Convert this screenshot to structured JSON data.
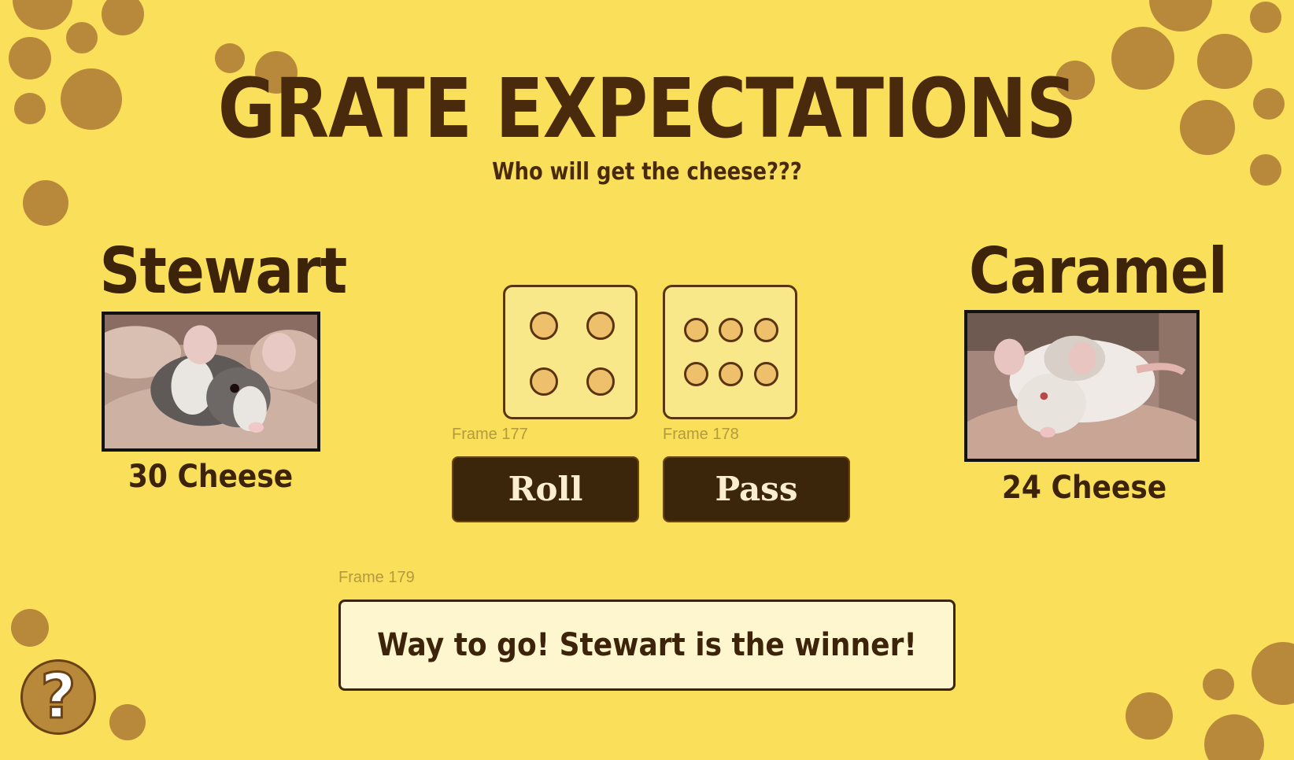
{
  "header": {
    "title": "GRATE EXPECTATIONS",
    "subtitle": "Who will get the cheese???"
  },
  "players": [
    {
      "name": "Stewart",
      "score": "30 Cheese",
      "photo": "mouse-photo-stewart"
    },
    {
      "name": "Caramel",
      "score": "24 Cheese",
      "photo": "mouse-photo-caramel"
    }
  ],
  "dice": [
    {
      "label": "Frame 177",
      "value": 4
    },
    {
      "label": "Frame 178",
      "value": 6
    }
  ],
  "controls": {
    "roll_label": "Roll",
    "pass_label": "Pass"
  },
  "message": {
    "frame_label": "Frame 179",
    "text": "Way to go! Stewart is the winner!"
  },
  "help": {
    "label": "?",
    "icon": "question-mark-icon"
  },
  "colors": {
    "background": "#f9df5a",
    "spots": "#b8893a",
    "text": "#3d230a",
    "button": "#3c260b",
    "die_face": "#f8e88a",
    "pip": "#eec06b",
    "message_bg": "#fdf6cf"
  }
}
